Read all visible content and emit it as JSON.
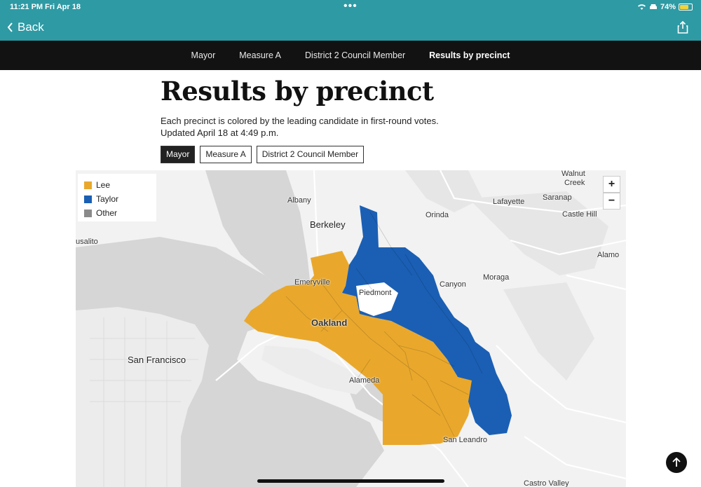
{
  "status": {
    "time": "11:21 PM",
    "date": "Fri Apr 18",
    "battery": "74%",
    "battery_level": 0.74
  },
  "header": {
    "back_label": "Back",
    "back_icon": "chevron-left-icon",
    "share_icon": "share-icon"
  },
  "nav": {
    "items": [
      "Mayor",
      "Measure A",
      "District 2 Council Member",
      "Results by precinct"
    ],
    "active_index": 3
  },
  "article": {
    "title": "Results by precinct",
    "subtitle_line1": "Each precinct is colored by the leading candidate in first-round votes.",
    "subtitle_line2": "Updated April 18 at 4:49 p.m."
  },
  "toggles": {
    "items": [
      "Mayor",
      "Measure A",
      "District 2 Council Member"
    ],
    "active_index": 0
  },
  "map": {
    "legend": [
      {
        "label": "Lee",
        "color": "#e9a82c"
      },
      {
        "label": "Taylor",
        "color": "#1a5fb4"
      },
      {
        "label": "Other",
        "color": "#8a8a8a"
      }
    ],
    "zoom_in": "+",
    "zoom_out": "−",
    "places": {
      "walnut_creek_1": "Walnut",
      "walnut_creek_2": "Creek",
      "albany": "Albany",
      "lafayette": "Lafayette",
      "saranap": "Saranap",
      "orinda": "Orinda",
      "castle_hill": "Castle Hill",
      "berkeley": "Berkeley",
      "sausalito": "usalito",
      "alamo": "Alamo",
      "emeryville": "Emeryville",
      "piedmont": "Piedmont",
      "moraga": "Moraga",
      "canyon": "Canyon",
      "oakland": "Oakland",
      "san_francisco": "San Francisco",
      "alameda": "Alameda",
      "san_leandro": "San Leandro",
      "castro_valley": "Castro Valley"
    }
  },
  "scroll_top_icon": "arrow-up-icon"
}
